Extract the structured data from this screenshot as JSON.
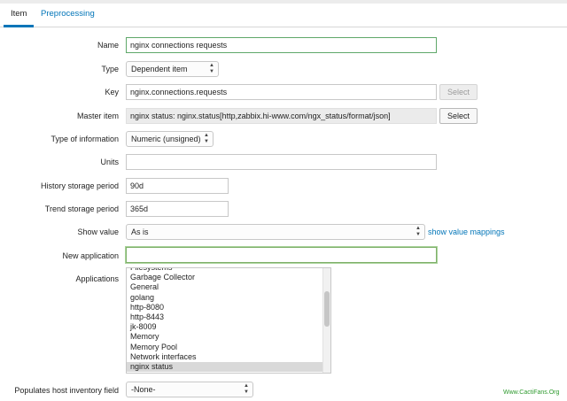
{
  "tabs": [
    {
      "label": "Item"
    },
    {
      "label": "Preprocessing"
    }
  ],
  "form": {
    "name": {
      "label": "Name",
      "value": "nginx connections requests"
    },
    "type": {
      "label": "Type",
      "value": "Dependent item"
    },
    "key": {
      "label": "Key",
      "value": "nginx.connections.requests",
      "select_label": "Select"
    },
    "master_item": {
      "label": "Master item",
      "value": "nginx status: nginx.status[http,zabbix.hi-www.com/ngx_status/format/json]",
      "select_label": "Select"
    },
    "type_of_information": {
      "label": "Type of information",
      "value": "Numeric (unsigned)"
    },
    "units": {
      "label": "Units",
      "value": ""
    },
    "history": {
      "label": "History storage period",
      "value": "90d"
    },
    "trend": {
      "label": "Trend storage period",
      "value": "365d"
    },
    "show_value": {
      "label": "Show value",
      "value": "As is",
      "link": "show value mappings"
    },
    "new_application": {
      "label": "New application",
      "value": ""
    },
    "applications": {
      "label": "Applications",
      "items": [
        "Filesystems",
        "Garbage Collector",
        "General",
        "golang",
        "http-8080",
        "http-8443",
        "jk-8009",
        "Memory",
        "Memory Pool",
        "Network interfaces",
        "nginx status"
      ],
      "selected": "nginx status"
    },
    "inventory": {
      "label": "Populates host inventory field",
      "value": "-None-"
    }
  },
  "watermark": "Www.CactiFans.Org",
  "colors": {
    "accent": "#0275b8",
    "focus_border": "#7fb06b",
    "watermark": "#2e9a2e"
  }
}
